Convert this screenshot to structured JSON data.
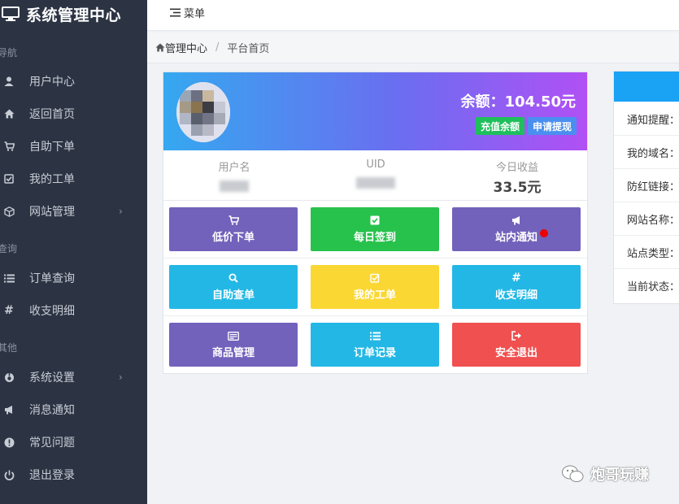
{
  "brand": {
    "title": "系统管理中心"
  },
  "sidebar": {
    "sections": [
      {
        "label": "导航"
      },
      {
        "label": "查询"
      },
      {
        "label": "其他"
      }
    ],
    "items": [
      {
        "label": "用户中心",
        "icon": "user-icon"
      },
      {
        "label": "返回首页",
        "icon": "home-icon"
      },
      {
        "label": "自助下单",
        "icon": "cart-icon"
      },
      {
        "label": "我的工单",
        "icon": "checkbox-icon"
      },
      {
        "label": "网站管理",
        "icon": "cube-icon",
        "has_submenu": true
      },
      {
        "label": "订单查询",
        "icon": "list-icon"
      },
      {
        "label": "收支明细",
        "icon": "hashtag-icon"
      },
      {
        "label": "系统设置",
        "icon": "settings-icon",
        "has_submenu": true
      },
      {
        "label": "消息通知",
        "icon": "megaphone-icon"
      },
      {
        "label": "常见问题",
        "icon": "exclamation-icon"
      },
      {
        "label": "退出登录",
        "icon": "power-icon"
      }
    ]
  },
  "topbar": {
    "menu_label": "菜单"
  },
  "breadcrumb": {
    "home": "管理中心",
    "current": "平台首页"
  },
  "account": {
    "balance_text": "余额：104.50元",
    "recharge_label": "充值余额",
    "withdraw_label": "申请提现"
  },
  "stats": [
    {
      "label": "用户名",
      "value": ""
    },
    {
      "label": "UID",
      "value": ""
    },
    {
      "label": "今日收益",
      "value": "33.5元"
    }
  ],
  "tiles": [
    {
      "label": "低价下单",
      "icon": "cart-icon",
      "color": "#7262bb"
    },
    {
      "label": "每日签到",
      "icon": "checkbox-icon",
      "color": "#27c24c"
    },
    {
      "label": "站内通知",
      "icon": "megaphone-icon",
      "color": "#7262bb",
      "has_dot": true
    },
    {
      "label": "自助查单",
      "icon": "search-icon",
      "color": "#23b7e5"
    },
    {
      "label": "我的工单",
      "icon": "edit-check-icon",
      "color": "#fad733"
    },
    {
      "label": "收支明细",
      "icon": "hashtag-icon",
      "color": "#23b7e5"
    },
    {
      "label": "商品管理",
      "icon": "card-icon",
      "color": "#7262bb"
    },
    {
      "label": "订单记录",
      "icon": "list-icon",
      "color": "#23b7e5"
    },
    {
      "label": "安全退出",
      "icon": "sign-out-icon",
      "color": "#f05050"
    }
  ],
  "site_info": {
    "rows": [
      {
        "label": "通知提醒："
      },
      {
        "label": "我的域名："
      },
      {
        "label": "防红链接："
      },
      {
        "label": "网站名称："
      },
      {
        "label": "站点类型："
      },
      {
        "label": "当前状态："
      }
    ]
  },
  "watermark": {
    "text": "炮哥玩赚"
  }
}
